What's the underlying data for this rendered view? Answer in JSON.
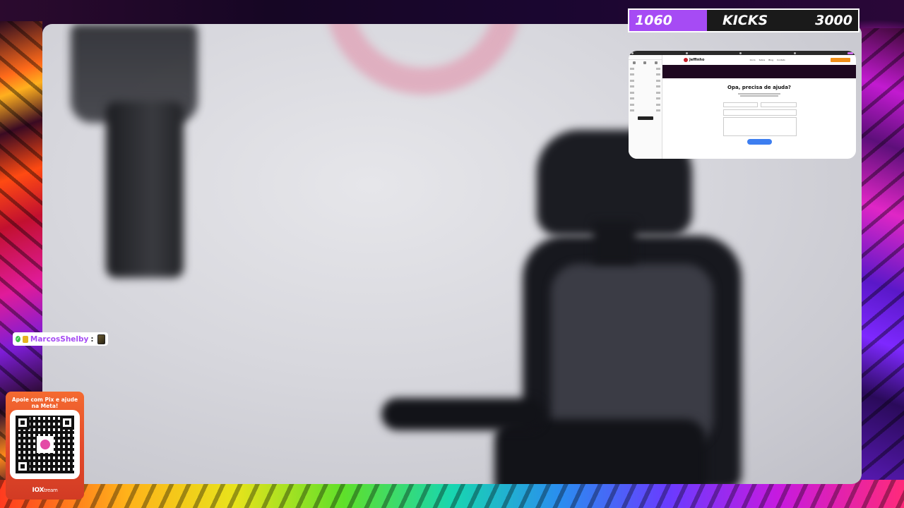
{
  "goal": {
    "current": "1060",
    "label": "KICKS",
    "target": "3000",
    "accent_color": "#a64bf4"
  },
  "shared_screen": {
    "site": {
      "brand": "Jeffinho",
      "nav": [
        "Início",
        "Sobre",
        "Blog",
        "Contato"
      ]
    },
    "form": {
      "title": "Opa, precisa de ajuda?"
    }
  },
  "chat": {
    "username": "MarcosShelby",
    "separator": ":",
    "username_color": "#a64bf4"
  },
  "donation": {
    "text": "Apoie com Pix e ajude na Meta!",
    "brand_main": "IOX",
    "brand_suffix": "tream"
  }
}
